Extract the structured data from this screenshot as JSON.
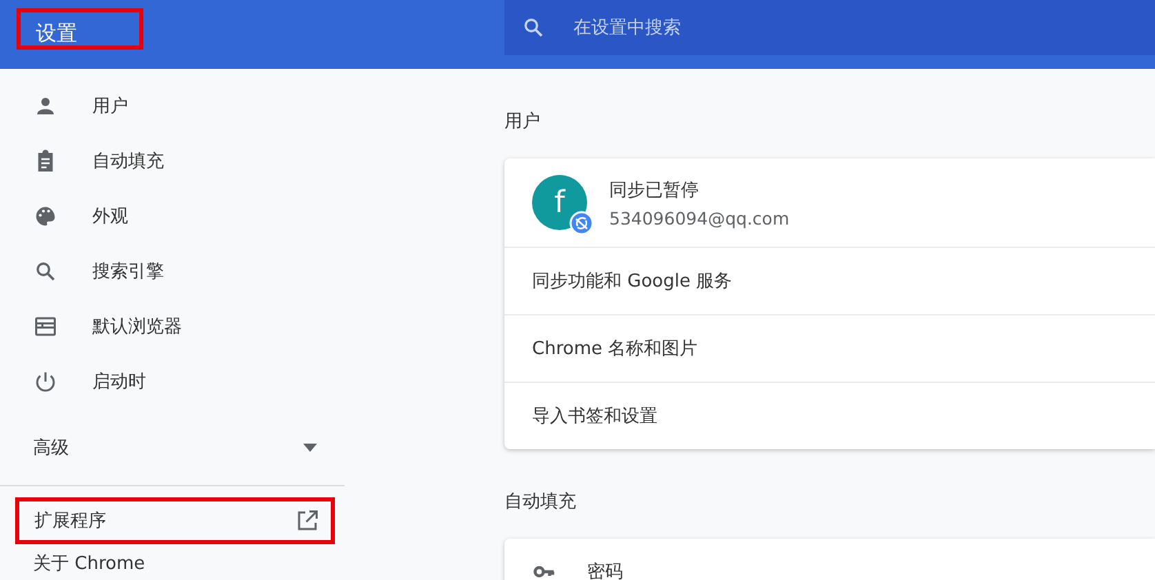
{
  "header": {
    "title": "设置",
    "title_highlighted": true,
    "search": {
      "placeholder": "在设置中搜索"
    }
  },
  "sidebar": {
    "items": [
      {
        "kind": "person",
        "label": "用户"
      },
      {
        "kind": "clipboard",
        "label": "自动填充"
      },
      {
        "kind": "palette",
        "label": "外观"
      },
      {
        "kind": "search",
        "label": "搜索引擎"
      },
      {
        "kind": "browser",
        "label": "默认浏览器"
      },
      {
        "kind": "power",
        "label": "启动时"
      }
    ],
    "advanced": {
      "label": "高级",
      "expanded": false
    },
    "extensions": {
      "label": "扩展程序",
      "highlighted": true
    },
    "about": {
      "label": "关于 Chrome"
    }
  },
  "sections": [
    {
      "title": "用户",
      "profile": {
        "initial": "f",
        "status": "同步已暂停",
        "email": "534096094@qq.com"
      },
      "rows": [
        {
          "label": "同步功能和 Google 服务"
        },
        {
          "label": "Chrome 名称和图片"
        },
        {
          "label": "导入书签和设置"
        }
      ]
    },
    {
      "title": "自动填充",
      "rows": [
        {
          "label": "密码",
          "kind": "key"
        }
      ]
    }
  ]
}
